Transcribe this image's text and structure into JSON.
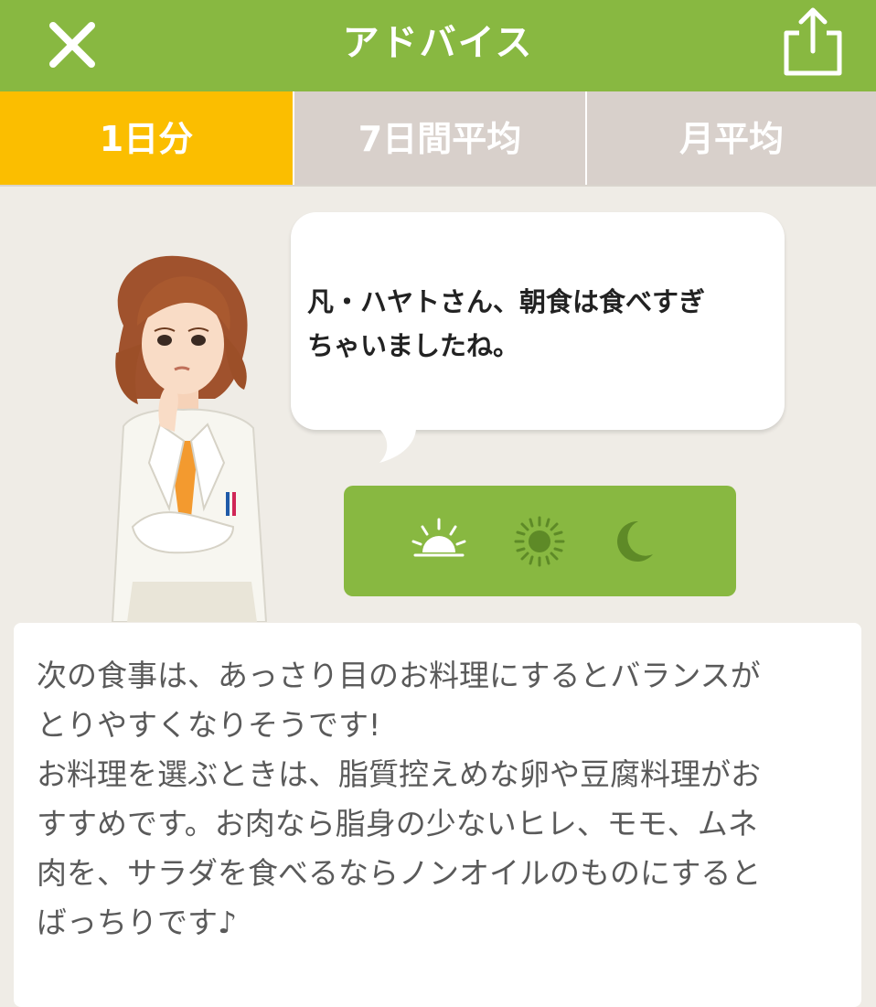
{
  "header": {
    "title": "アドバイス",
    "close_icon": "close-icon",
    "share_icon": "share-icon",
    "background_color": "#88b841"
  },
  "tabs": [
    {
      "label": "1日分",
      "active": true,
      "color": "#fbbe00"
    },
    {
      "label": "7日間平均",
      "active": false,
      "color": "#d8d0cb"
    },
    {
      "label": "月平均",
      "active": false,
      "color": "#d8d0cb"
    }
  ],
  "bubble": {
    "lines": [
      "凡・ハヤトさん、朝食は食べすぎ",
      "ちゃいましたね。"
    ]
  },
  "meal_selector": {
    "items": [
      {
        "icon": "sunrise-icon",
        "selected": true
      },
      {
        "icon": "sun-icon",
        "selected": false
      },
      {
        "icon": "moon-icon",
        "selected": false
      }
    ]
  },
  "advice": {
    "lines": [
      "次の食事は、あっさり目のお料理にするとバランスが",
      "とりやすくなりそうです!",
      "お料理を選ぶときは、脂質控えめな卵や豆腐料理がお",
      "すすめです。お肉なら脂身の少ないヒレ、モモ、ムネ",
      "肉を、サラダを食べるならノンオイルのものにすると",
      "ばっちりです♪"
    ]
  }
}
